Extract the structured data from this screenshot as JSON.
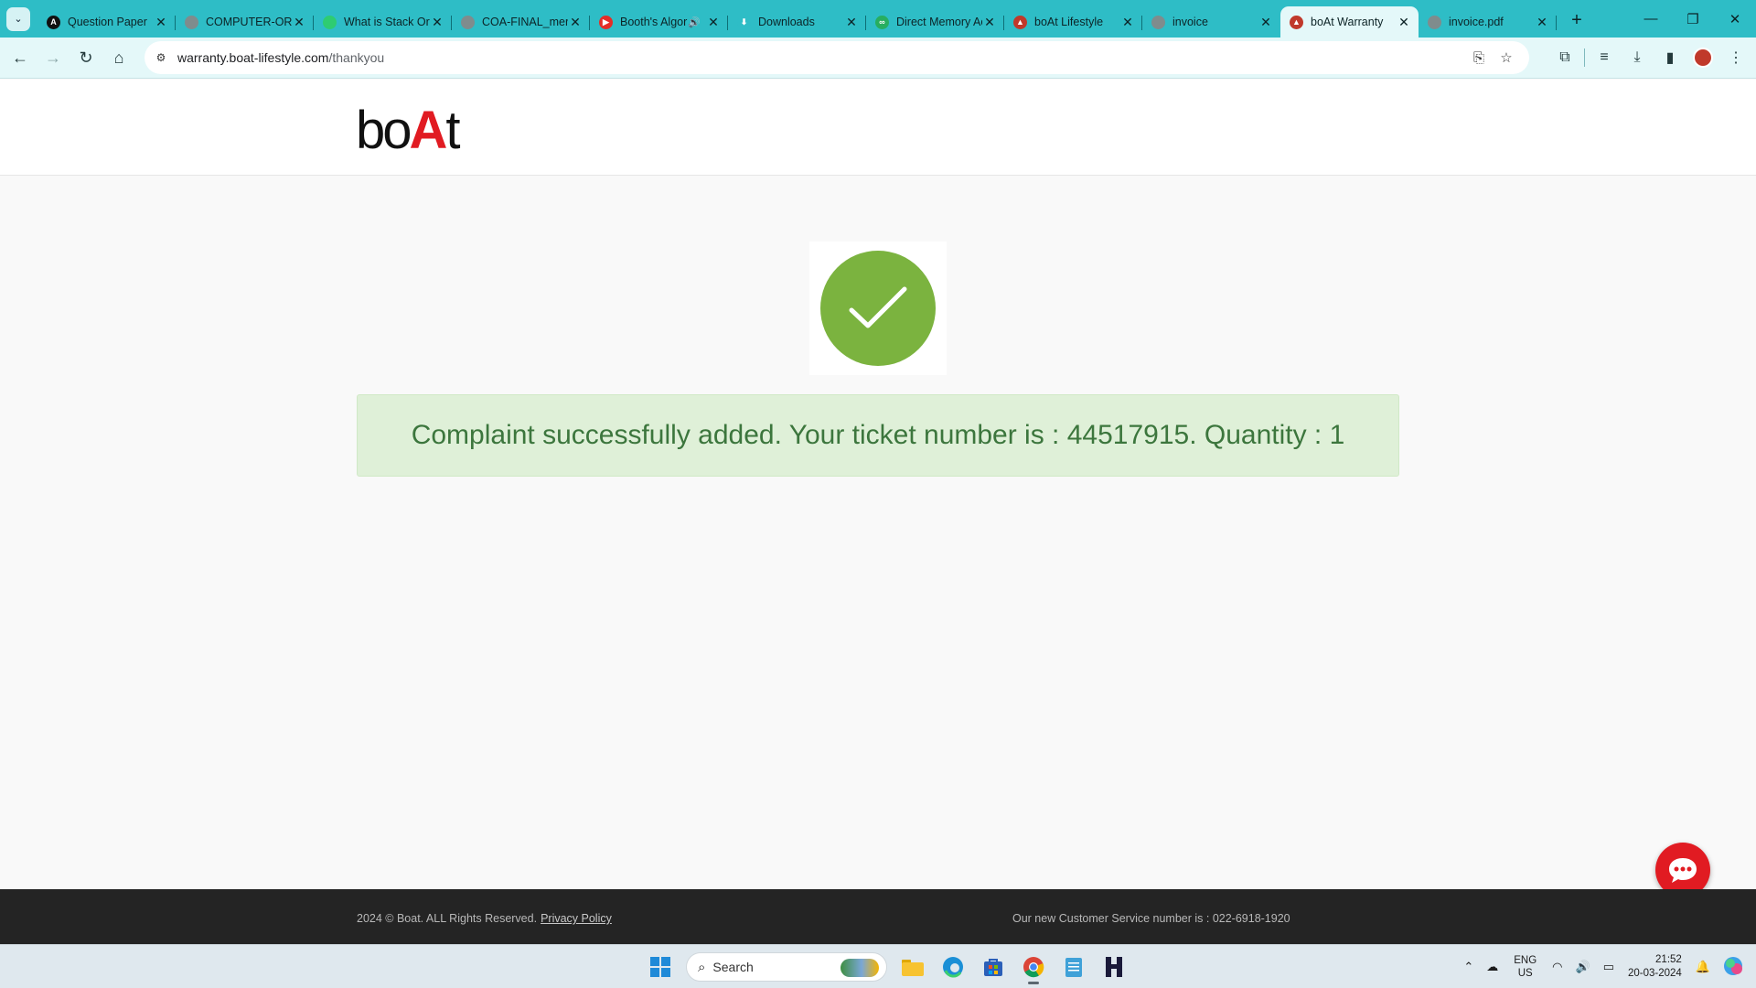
{
  "browser": {
    "tabs": [
      {
        "title": "Question Paper",
        "favicon_color": "#111111",
        "favicon_glyph": "A"
      },
      {
        "title": "COMPUTER-ORGANIZATION",
        "favicon_color": "#7f8c8d",
        "favicon_glyph": ""
      },
      {
        "title": "What is Stack Organization",
        "favicon_color": "#2ecc71",
        "favicon_glyph": ""
      },
      {
        "title": "COA-FINAL_merged",
        "favicon_color": "#7f8c8d",
        "favicon_glyph": ""
      },
      {
        "title": "Booth's Algorithm",
        "favicon_color": "#e52d27",
        "favicon_glyph": "▶",
        "audio": "🔊"
      },
      {
        "title": "Downloads",
        "favicon_color": "#2ebdc6",
        "favicon_glyph": "⬇"
      },
      {
        "title": "Direct Memory Access",
        "favicon_color": "#27ae60",
        "favicon_glyph": "∞"
      },
      {
        "title": "boAt Lifestyle",
        "favicon_color": "#c0392b",
        "favicon_glyph": "▲"
      },
      {
        "title": "invoice",
        "favicon_color": "#7f8c8d",
        "favicon_glyph": ""
      },
      {
        "title": "boAt Warranty",
        "favicon_color": "#c0392b",
        "favicon_glyph": "▲",
        "active": true
      },
      {
        "title": "invoice.pdf",
        "favicon_color": "#7f8c8d",
        "favicon_glyph": ""
      }
    ],
    "close_glyph": "✕",
    "new_tab_glyph": "+",
    "window": {
      "minimize": "—",
      "restore": "❐",
      "close": "✕"
    },
    "nav": {
      "back": "←",
      "forward": "→",
      "reload": "↻",
      "home": "⌂"
    },
    "address": {
      "host": "warranty.boat-lifestyle.com",
      "path": "/thankyou",
      "site_info_icon": "⚙"
    },
    "omni_icons": {
      "translate": "⎘",
      "bookmark": "☆"
    },
    "toolbar_icons": {
      "extensions": "⧉",
      "media": "≡",
      "download": "⤓",
      "sidepanel": "▮",
      "menu": "⋮"
    }
  },
  "page": {
    "logo": {
      "part1": "bo",
      "part2": "A",
      "part3": "t"
    },
    "message": "Complaint successfully added. Your ticket number is : 44517915. Quantity : 1",
    "ticket_number": "44517915",
    "quantity": "1",
    "status": "success",
    "colors": {
      "success_green": "#7bb33f",
      "alert_bg": "#dff0d8",
      "alert_text": "#3c763d",
      "brand_red": "#e11b22"
    },
    "footer": {
      "copyright": "2024 © Boat. ALL Rights Reserved.",
      "privacy_link": "Privacy Policy",
      "customer_service": "Our new Customer Service number is : 022-6918-1920"
    }
  },
  "taskbar": {
    "search_placeholder": "Search",
    "search_icon": "⌕",
    "apps": [
      {
        "name": "start",
        "running": false
      },
      {
        "name": "file-explorer",
        "running": false
      },
      {
        "name": "edge",
        "running": false
      },
      {
        "name": "store",
        "running": false
      },
      {
        "name": "chrome",
        "running": true
      },
      {
        "name": "notepad",
        "running": false
      },
      {
        "name": "h-app",
        "running": false
      }
    ],
    "tray": {
      "chevron": "⌃",
      "cloud": "☁",
      "lang_line1": "ENG",
      "lang_line2": "US",
      "wifi": "◠",
      "volume": "🔊",
      "battery": "▭",
      "time": "21:52",
      "date": "20-03-2024",
      "bell": "🔔"
    }
  }
}
